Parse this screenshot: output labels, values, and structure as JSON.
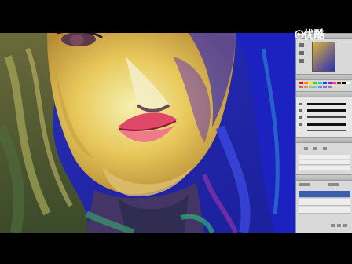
{
  "watermark": {
    "text": "优酷",
    "logo_icon": "youku-logo-icon"
  },
  "colors": {
    "letterbox": "#000000",
    "panel_bg": "#d6d6d6",
    "selected_layer": "#3a61b0"
  }
}
